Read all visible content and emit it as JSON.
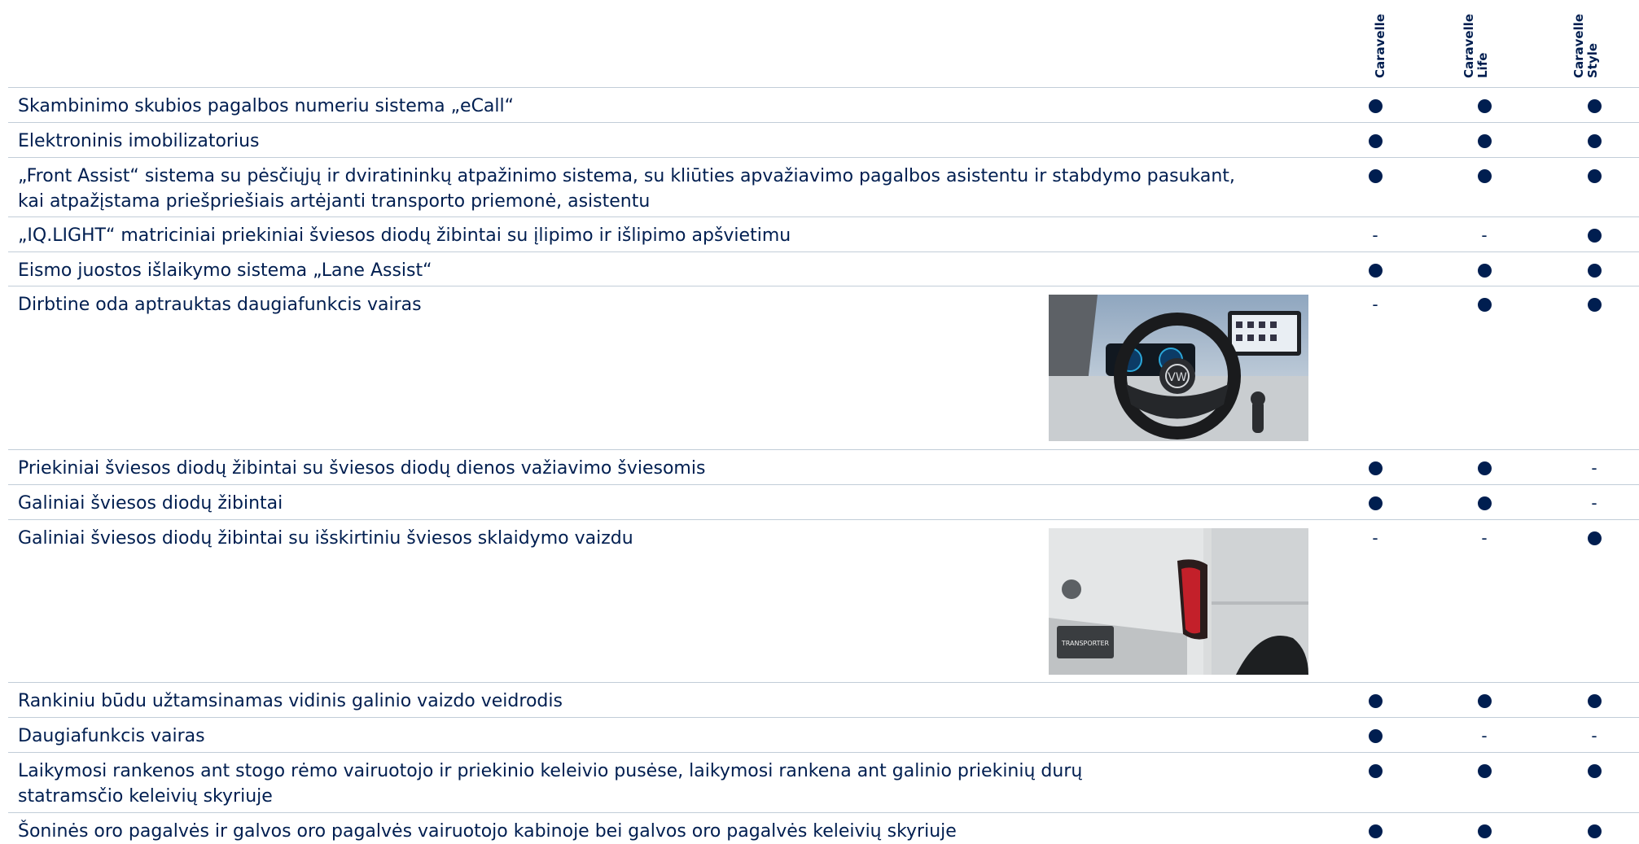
{
  "columns": [
    "Caravelle",
    "Caravelle\nLife",
    "Caravelle\nStyle"
  ],
  "rows": [
    {
      "label": "Skambinimo skubios pagalbos numeriu sistema „eCall“",
      "marks": [
        "●",
        "●",
        "●"
      ]
    },
    {
      "label": "Elektroninis imobilizatorius",
      "marks": [
        "●",
        "●",
        "●"
      ]
    },
    {
      "label": "„Front Assist“ sistema su pėsčiųjų ir dviratininkų atpažinimo sistema, su kliūties apvažiavimo pagalbos asistentu ir stabdymo pasukant,\nkai atpažįstama priešpriešiais artėjanti transporto priemonė, asistentu",
      "marks": [
        "●",
        "●",
        "●"
      ]
    },
    {
      "label": "„IQ.LIGHT“ matriciniai priekiniai šviesos diodų žibintai su įlipimo ir išlipimo apšvietimu",
      "marks": [
        "-",
        "-",
        "●"
      ]
    },
    {
      "label": "Eismo juostos išlaikymo sistema „Lane Assist“",
      "marks": [
        "●",
        "●",
        "●"
      ]
    },
    {
      "label": "Dirbtine oda aptrauktas daugiafunkcis vairas",
      "marks": [
        "-",
        "●",
        "●"
      ],
      "image": "steering-wheel-photo"
    },
    {
      "label": "Priekiniai šviesos diodų žibintai su šviesos diodų dienos važiavimo šviesomis",
      "marks": [
        "●",
        "●",
        "-"
      ]
    },
    {
      "label": "Galiniai šviesos diodų žibintai",
      "marks": [
        "●",
        "●",
        "-"
      ]
    },
    {
      "label": "Galiniai šviesos diodų žibintai su išskirtiniu šviesos sklaidymo vaizdu",
      "marks": [
        "-",
        "-",
        "●"
      ],
      "image": "tail-light-photo"
    },
    {
      "label": "Rankiniu būdu užtamsinamas vidinis galinio vaizdo veidrodis",
      "marks": [
        "●",
        "●",
        "●"
      ]
    },
    {
      "label": "Daugiafunkcis vairas",
      "marks": [
        "●",
        "-",
        "-"
      ]
    },
    {
      "label": "Laikymosi rankenos ant stogo rėmo vairuotojo ir priekinio keleivio pusėse, laikymosi rankena ant galinio priekinių durų\nstatramsčio keleivių skyriuje",
      "marks": [
        "●",
        "●",
        "●"
      ]
    },
    {
      "label": "Šoninės oro pagalvės ir galvos oro pagalvės vairuotojo kabinoje bei galvos oro pagalvės keleivių skyriuje",
      "marks": [
        "●",
        "●",
        "●"
      ]
    }
  ],
  "colors": {
    "text": "#001e50",
    "divider": "#c2cdd8"
  }
}
